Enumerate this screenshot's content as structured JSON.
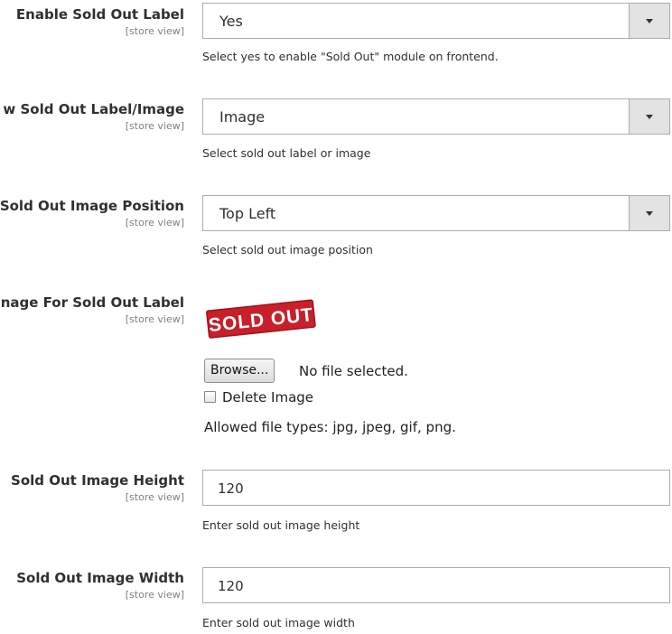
{
  "fields": {
    "enable_label": {
      "label": "Enable Sold Out Label",
      "scope": "[store view]",
      "value": "Yes",
      "note": "Select yes to enable \"Sold Out\" module on frontend."
    },
    "show_label_image": {
      "label": "w Sold Out Label/Image",
      "scope": "[store view]",
      "value": "Image",
      "note": "Select sold out label or image"
    },
    "image_position": {
      "label": "Sold Out Image Position",
      "scope": "[store view]",
      "value": "Top Left",
      "note": "Select sold out image position"
    },
    "image_for_label": {
      "label": "nage For Sold Out Label",
      "scope": "[store view]",
      "image_text": "SOLD OUT",
      "browse_label": "Browse...",
      "file_status": "No file selected.",
      "delete_label": "Delete Image",
      "allowed_types": "Allowed file types: jpg, jpeg, gif, png."
    },
    "image_height": {
      "label": "Sold Out Image Height",
      "scope": "[store view]",
      "value": "120",
      "note": "Enter sold out image height"
    },
    "image_width": {
      "label": "Sold Out Image Width",
      "scope": "[store view]",
      "value": "120",
      "note": "Enter sold out image width"
    }
  },
  "colors": {
    "sold_out_red": "#c8202a",
    "input_border": "#adadad",
    "dropdown_button": "#e3e3e3"
  },
  "icons": {
    "dropdown_arrow": "chevron-down-icon"
  }
}
